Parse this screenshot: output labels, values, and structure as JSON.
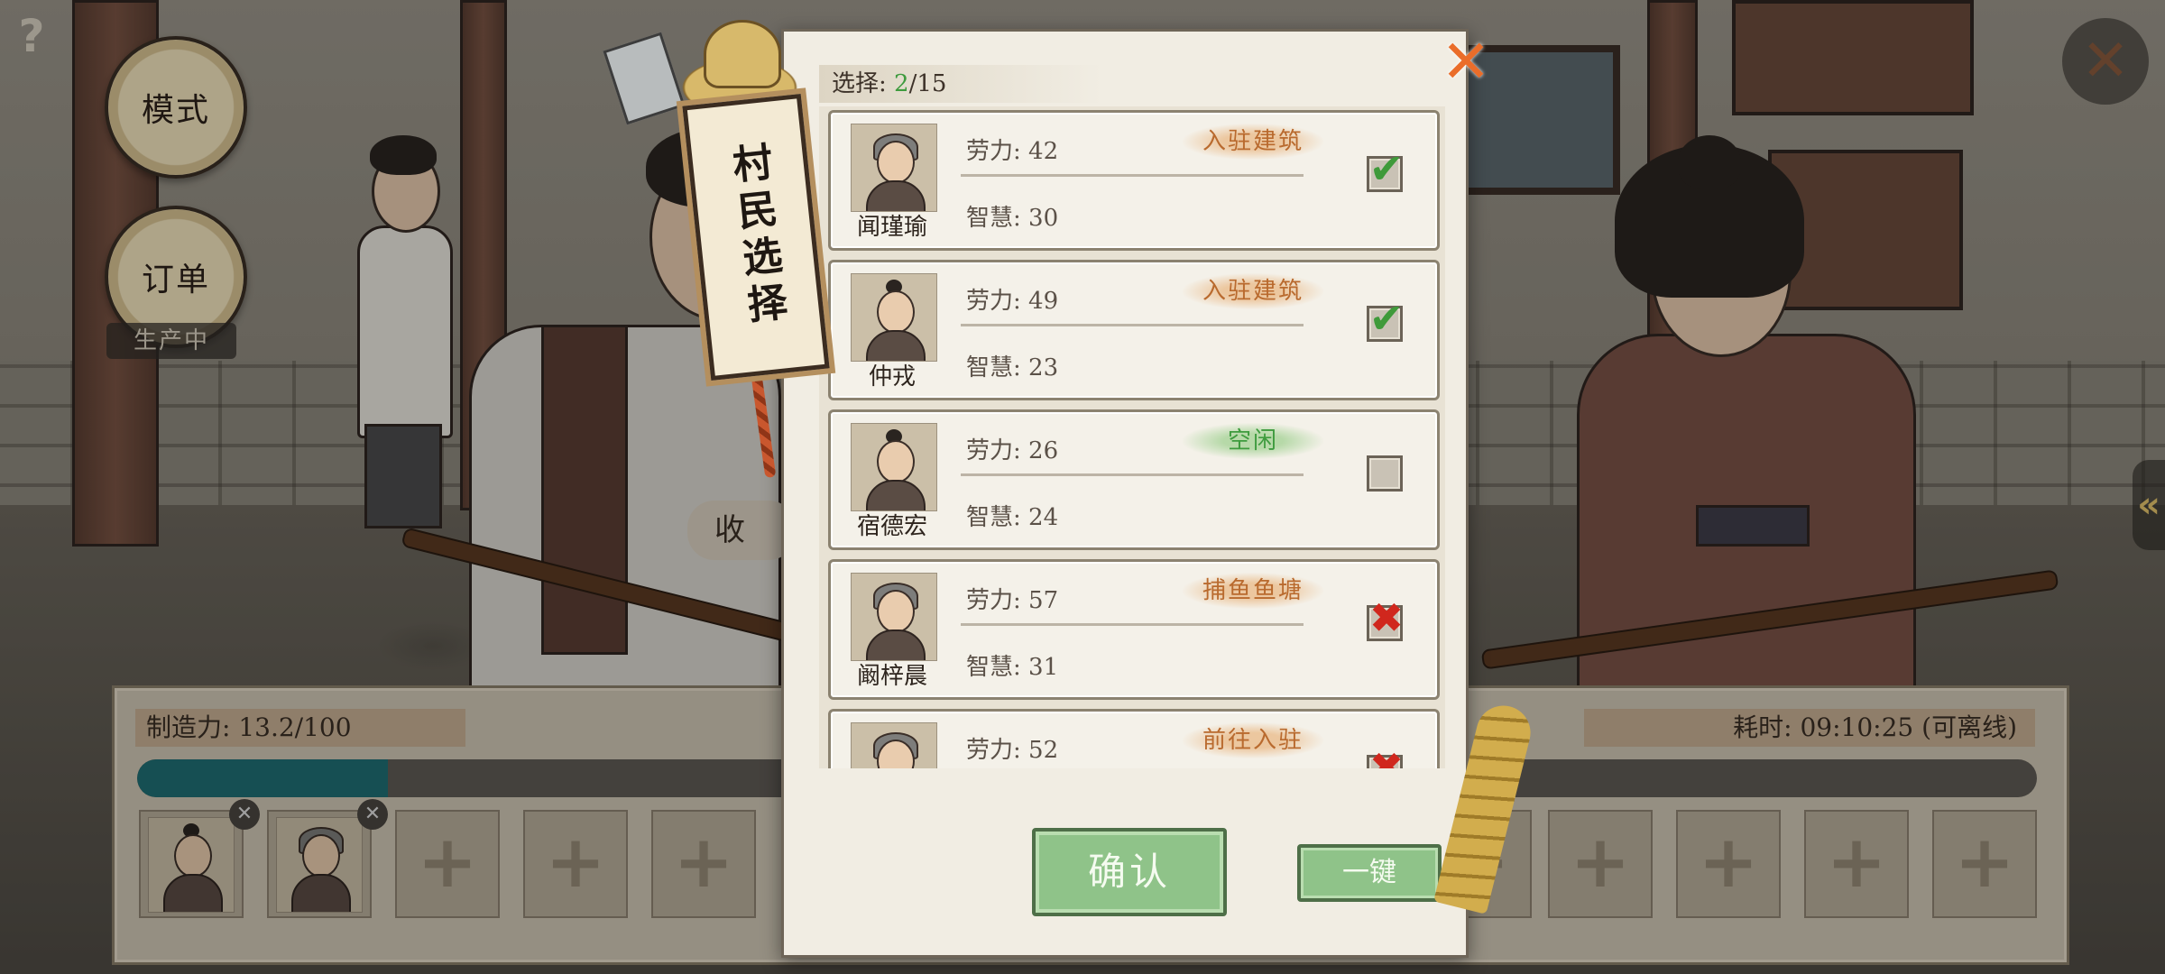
{
  "hud": {
    "help": "?",
    "mode_button": "模式",
    "orders_button": "订单",
    "producing_tag": "生产中",
    "collect_chip": "收",
    "close": "✕",
    "side_arrow": "«"
  },
  "production": {
    "power_label": "制造力: 13.2/100",
    "time_label": "耗时: 09:10:25 (可离线)",
    "progress_fraction": 0.132,
    "slots_filled": 2,
    "slot_add": "+",
    "slot_remove": "✕"
  },
  "modal": {
    "title": "村民选择",
    "selection_prefix": "选择: ",
    "selection_current": "2",
    "selection_total": "/15",
    "close": "✕",
    "confirm": "确认",
    "one_key": "一键",
    "villagers": [
      {
        "name": "闻瑾瑜",
        "labor": "劳力: 42",
        "wisdom": "智慧: 30",
        "status": "入驻建筑",
        "status_type": "busy",
        "check": "checked",
        "mark": "✔",
        "avatar": "hat"
      },
      {
        "name": "仲戎",
        "labor": "劳力: 49",
        "wisdom": "智慧: 23",
        "status": "入驻建筑",
        "status_type": "busy",
        "check": "checked",
        "mark": "✔",
        "avatar": "bun"
      },
      {
        "name": "宿德宏",
        "labor": "劳力: 26",
        "wisdom": "智慧: 24",
        "status": "空闲",
        "status_type": "idle",
        "check": "empty",
        "mark": "",
        "avatar": "bun"
      },
      {
        "name": "阚梓晨",
        "labor": "劳力: 57",
        "wisdom": "智慧: 31",
        "status": "捕鱼鱼塘",
        "status_type": "busy",
        "check": "blocked",
        "mark": "✖",
        "avatar": "hat"
      },
      {
        "name": "",
        "labor": "劳力: 52",
        "wisdom": "",
        "status": "前往入驻",
        "status_type": "busy",
        "check": "blocked",
        "mark": "✖",
        "avatar": "hat"
      }
    ]
  },
  "colors": {
    "accent_green": "#3e9b3e",
    "busy_orange": "#b96a2e",
    "progress_teal": "#1f6e74",
    "close_orange": "#ea6d2a"
  }
}
